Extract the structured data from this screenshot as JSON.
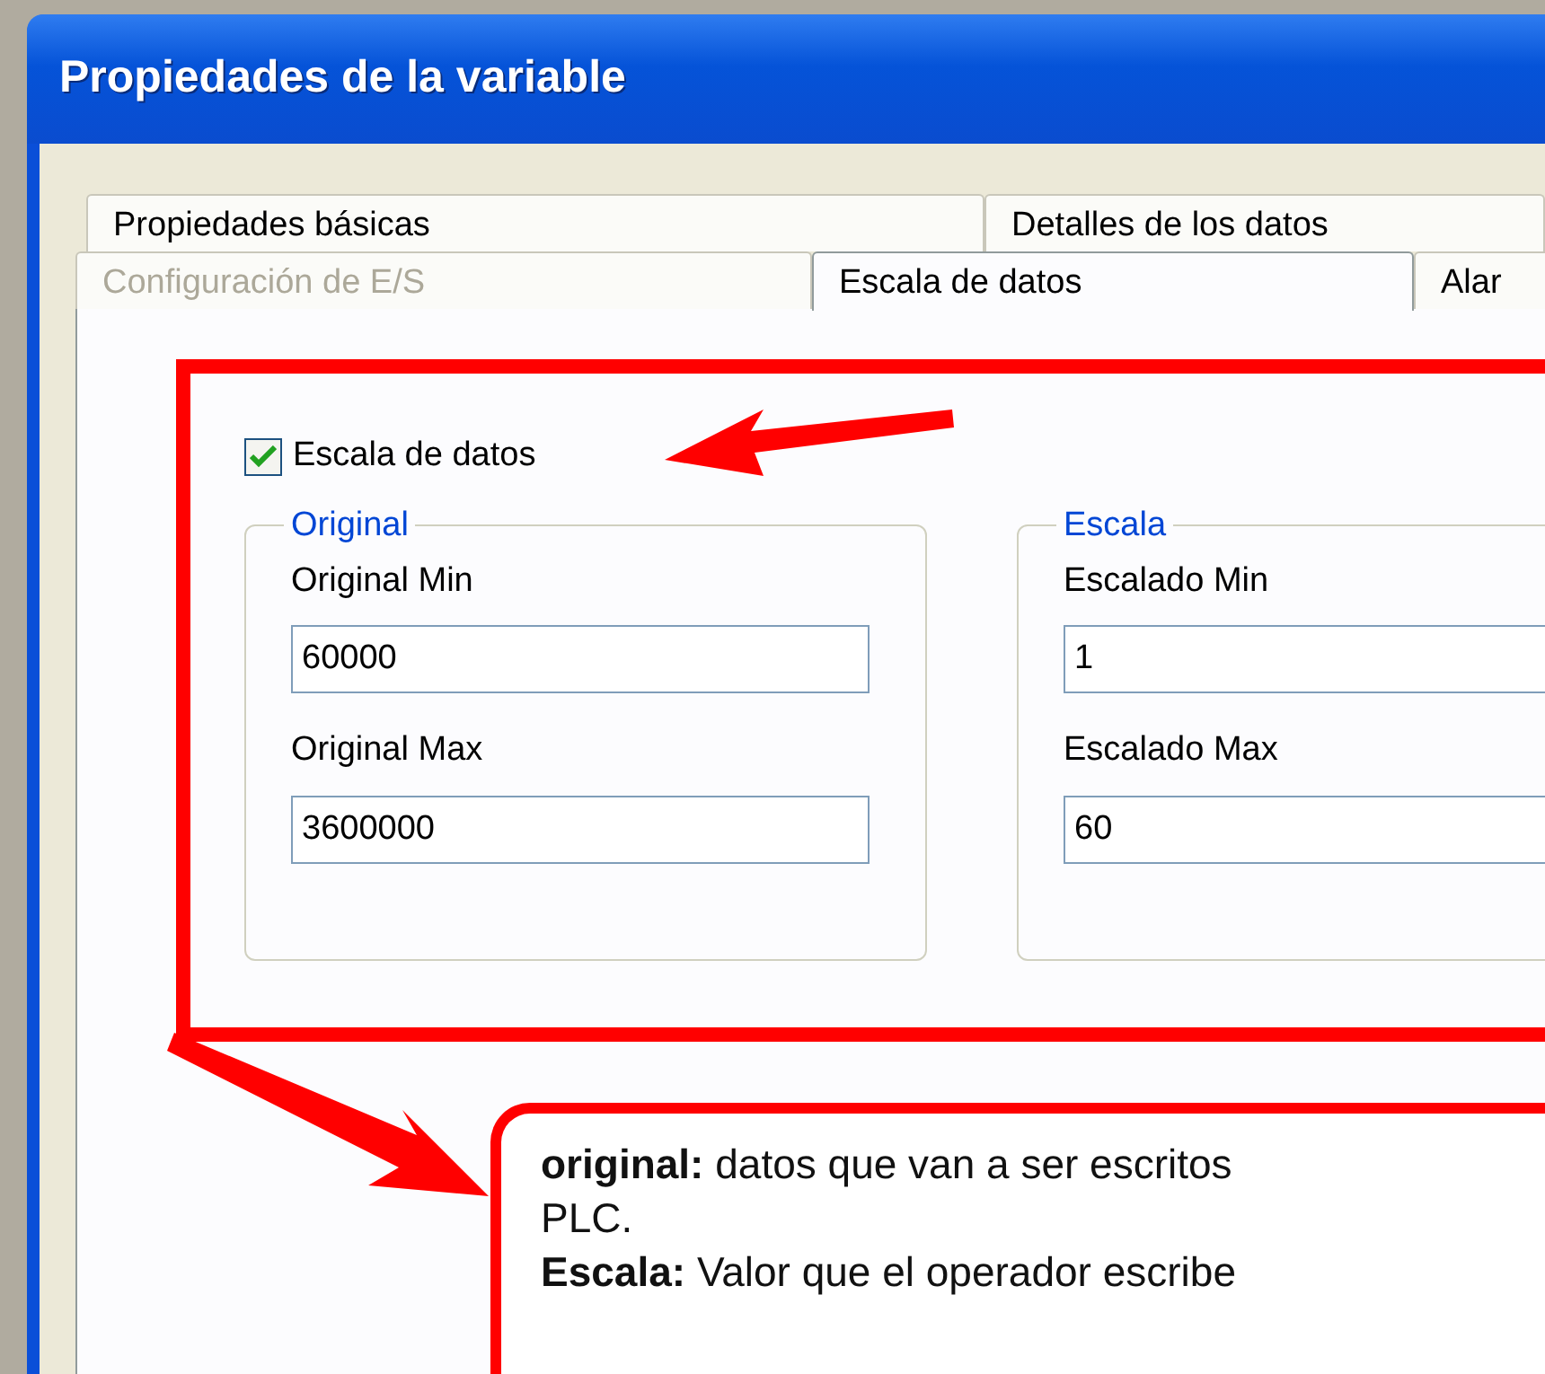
{
  "window": {
    "title": "Propiedades de la variable"
  },
  "tab_rows": [
    {
      "tabs": [
        {
          "label": "Propiedades básicas",
          "selected": false,
          "disabled": false
        },
        {
          "label": "Detalles de los datos",
          "selected": false,
          "disabled": false
        }
      ]
    },
    {
      "tabs": [
        {
          "label": "Configuración de E/S",
          "selected": false,
          "disabled": true
        },
        {
          "label": "Escala de datos",
          "selected": true,
          "disabled": false
        },
        {
          "label": "Alar",
          "selected": false,
          "disabled": false
        }
      ]
    }
  ],
  "scaling_checkbox": {
    "label": "Escala de datos",
    "checked": true
  },
  "groups": [
    {
      "title": "Original",
      "fields": [
        {
          "label": "Original Min",
          "value": "60000"
        },
        {
          "label": "Original Max",
          "value": "3600000"
        }
      ]
    },
    {
      "title": "Escala",
      "fields": [
        {
          "label": "Escalado Min",
          "value": "1"
        },
        {
          "label": "Escalado Max",
          "value": "60"
        }
      ]
    }
  ],
  "callout": {
    "lines": [
      "**original:** datos que van a ser escritos",
      "PLC.",
      "**Escala:** Valor que el operador escribe"
    ]
  }
}
